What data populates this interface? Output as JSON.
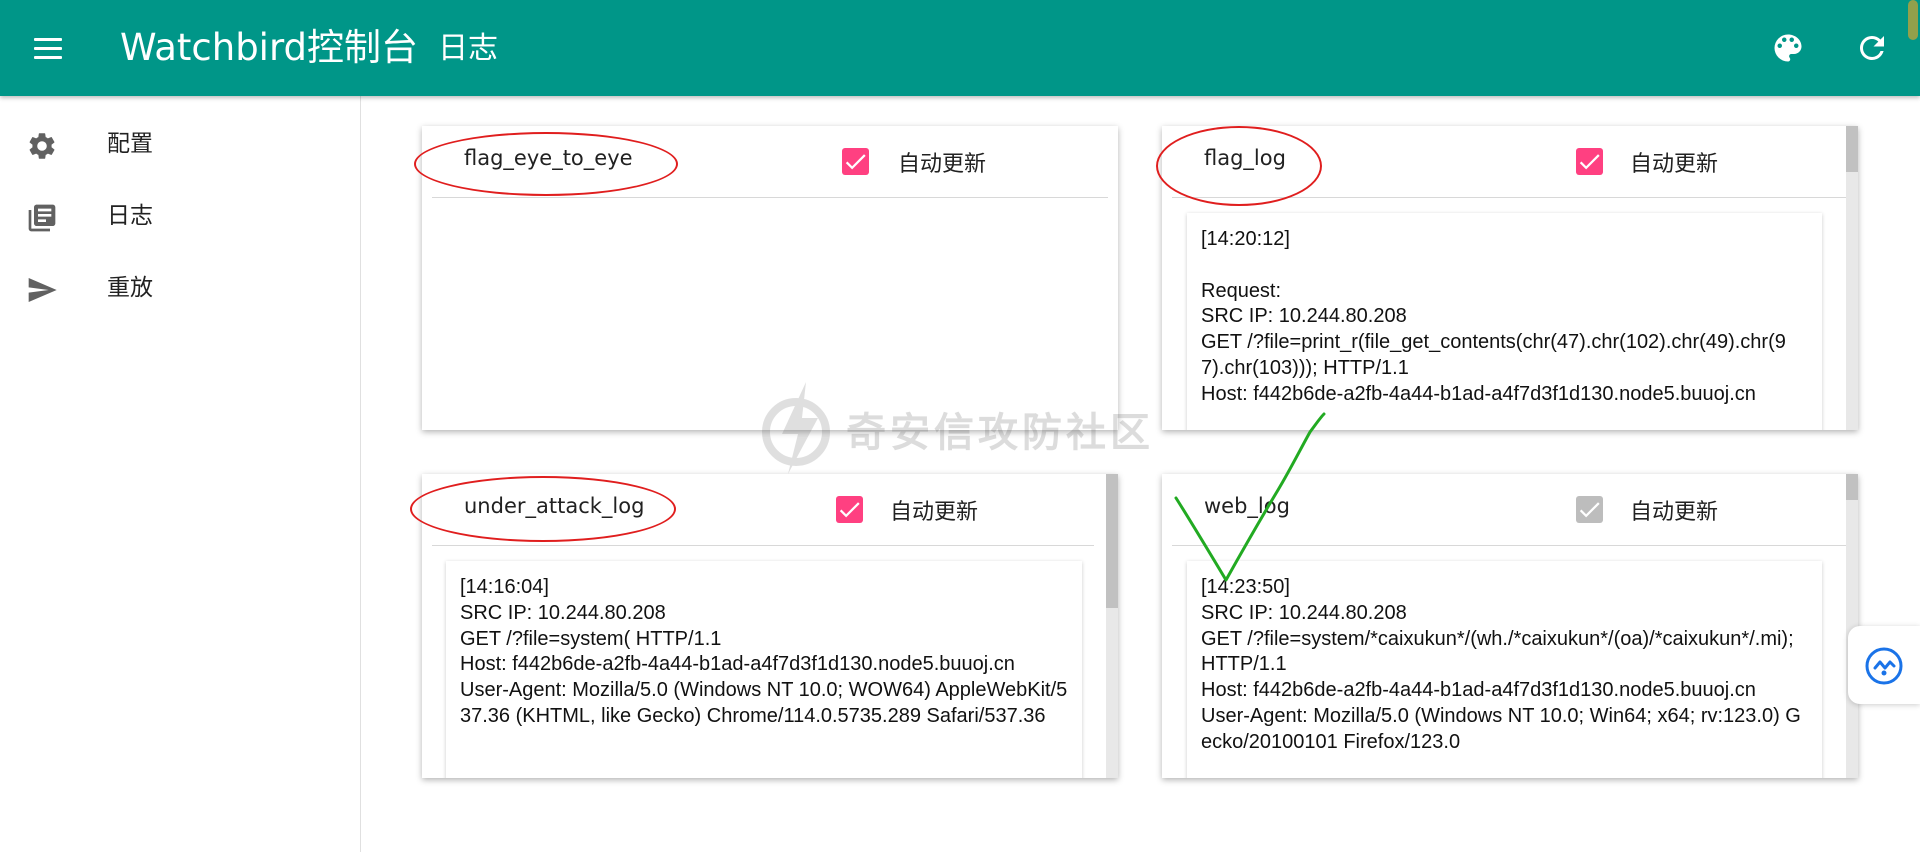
{
  "header": {
    "app_title": "Watchbird控制台",
    "page_title": "日志",
    "color": "#009688",
    "icons": [
      "menu-icon",
      "palette-icon",
      "refresh-icon"
    ]
  },
  "sidebar": {
    "items": [
      {
        "label": "配置",
        "icon": "gear-icon"
      },
      {
        "label": "日志",
        "icon": "library-books-icon"
      },
      {
        "label": "重放",
        "icon": "send-icon"
      }
    ]
  },
  "cards": [
    {
      "title": "flag_eye_to_eye",
      "auto_update_label": "自动更新",
      "auto_update_checked": true,
      "log": ""
    },
    {
      "title": "flag_log",
      "auto_update_label": "自动更新",
      "auto_update_checked": true,
      "log": "[14:20:12]\n\nRequest:\nSRC IP: 10.244.80.208\nGET /?file=print_r(file_get_contents(chr(47).chr(102).chr(49).chr(97).chr(103))); HTTP/1.1\nHost: f442b6de-a2fb-4a44-b1ad-a4f7d3f1d130.node5.buuoj.cn"
    },
    {
      "title": "under_attack_log",
      "auto_update_label": "自动更新",
      "auto_update_checked": true,
      "log": "[14:16:04]\nSRC IP: 10.244.80.208\nGET /?file=system( HTTP/1.1\nHost: f442b6de-a2fb-4a44-b1ad-a4f7d3f1d130.node5.buuoj.cn\nUser-Agent: Mozilla/5.0 (Windows NT 10.0; WOW64) AppleWebKit/537.36 (KHTML, like Gecko) Chrome/114.0.5735.289 Safari/537.36"
    },
    {
      "title": "web_log",
      "auto_update_label": "自动更新",
      "auto_update_checked": false,
      "log": "[14:23:50]\nSRC IP: 10.244.80.208\nGET /?file=system/*caixukun*/(wh./*caixukun*/(oa)/*caixukun*/.mi); HTTP/1.1\nHost: f442b6de-a2fb-4a44-b1ad-a4f7d3f1d130.node5.buuoj.cn\nUser-Agent: Mozilla/5.0 (Windows NT 10.0; Win64; x64; rv:123.0) Gecko/20100101 Firefox/123.0"
    }
  ],
  "watermark": {
    "text": "奇安信攻防社区"
  },
  "colors": {
    "checkbox_checked": "#ff4081",
    "checkbox_disabled": "#bdbdbd",
    "annotation_red": "#e01e1e",
    "annotation_green": "#22aa22"
  }
}
